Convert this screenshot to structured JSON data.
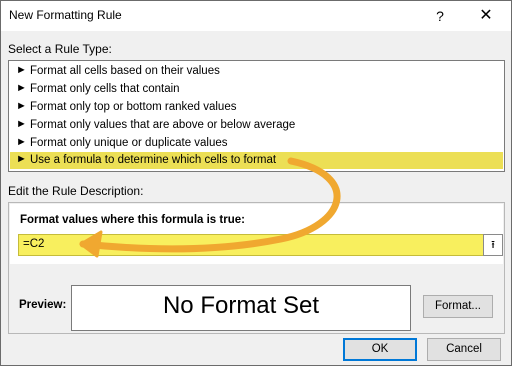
{
  "window": {
    "title": "New Formatting Rule",
    "help_label": "?",
    "close_label": "✕"
  },
  "rule_type": {
    "section_label": "Select a Rule Type:",
    "arrow_glyph": "►",
    "items": [
      {
        "label": "Format all cells based on their values"
      },
      {
        "label": "Format only cells that contain"
      },
      {
        "label": "Format only top or bottom ranked values"
      },
      {
        "label": "Format only values that are above or below average"
      },
      {
        "label": "Format only unique or duplicate values"
      },
      {
        "label": "Use a formula to determine which cells to format"
      }
    ],
    "selected_index": 5
  },
  "description": {
    "section_label": "Edit the Rule Description:",
    "formula_label": "Format values where this formula is true:",
    "formula_value": "=C2",
    "collapse_icon": "⭱",
    "preview_label": "Preview:",
    "preview_text": "No Format Set",
    "format_button": "Format..."
  },
  "footer": {
    "ok_label": "OK",
    "cancel_label": "Cancel"
  },
  "colors": {
    "highlight": "#ecdf55",
    "formula_bg": "#f8ef5e",
    "callout_arrow": "#f0a830",
    "accent": "#0078d7"
  }
}
